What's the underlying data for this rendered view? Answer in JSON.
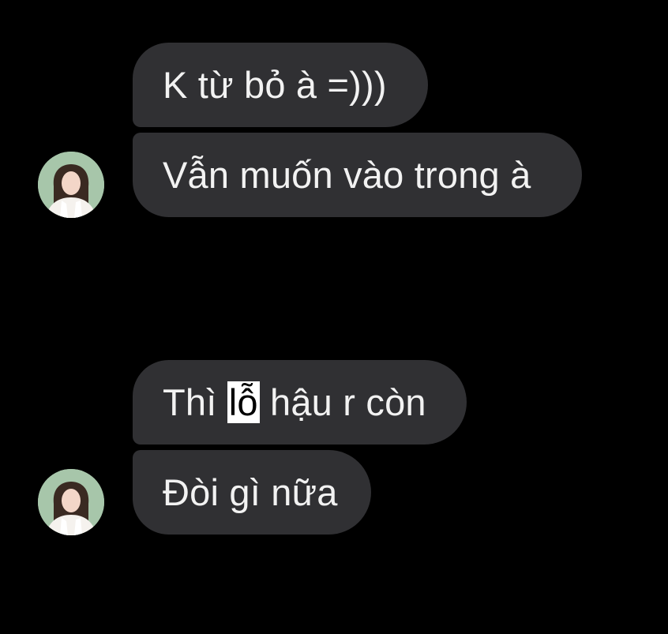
{
  "conversation": {
    "groups": [
      {
        "messages": [
          {
            "text": "K từ bỏ à =)))"
          },
          {
            "text": "Vẫn muốn vào trong à"
          }
        ],
        "avatar": "contact-avatar"
      },
      {
        "messages": [
          {
            "text_before": "Thì ",
            "highlighted": "lỗ",
            "text_after": " hậu r còn"
          },
          {
            "text": "Đòi gì nữa"
          }
        ],
        "avatar": "contact-avatar"
      }
    ]
  },
  "colors": {
    "background": "#000000",
    "bubble": "#303033",
    "text": "#f2f2f2",
    "highlight_bg": "#ffffff",
    "highlight_text": "#000000"
  }
}
